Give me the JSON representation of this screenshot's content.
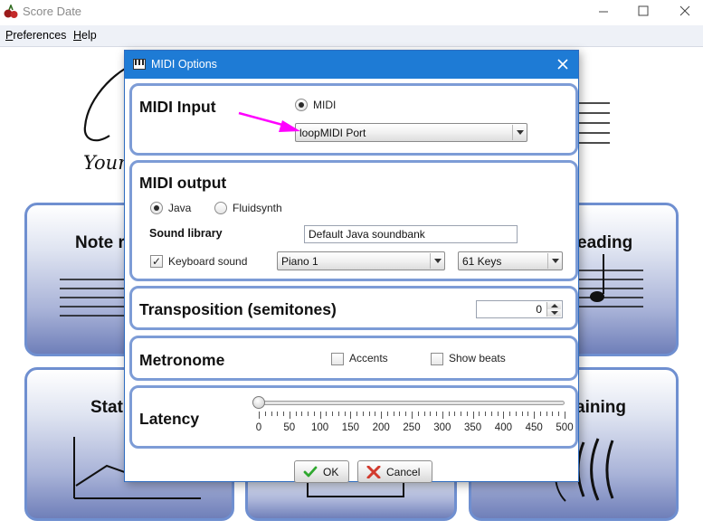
{
  "window": {
    "title": "Score Date",
    "controls": {
      "minimize": "minimize-icon",
      "maximize": "maximize-icon",
      "close": "close-icon"
    }
  },
  "menu": {
    "preferences": {
      "mnemonic": "P",
      "rest": "references"
    },
    "help": {
      "mnemonic": "H",
      "rest": "elp"
    }
  },
  "background": {
    "logo_tagline": "Your",
    "tiles": {
      "note_reading": "Note r",
      "rhythm_reading": "eading",
      "statistics": "Stat",
      "ear_training": "aining"
    }
  },
  "dialog": {
    "title": "MIDI Options",
    "icon": "piano-keyboard-icon",
    "midi_input": {
      "title": "MIDI Input",
      "radio_label": "MIDI",
      "radio_selected": true,
      "port": "loopMIDI Port"
    },
    "midi_output": {
      "title": "MIDI output",
      "radio_java": "Java",
      "radio_fluidsynth": "Fluidsynth",
      "selected": "Java",
      "sound_library_label": "Sound library",
      "sound_library_value": "Default Java soundbank",
      "keyboard_sound_label": "Keyboard sound",
      "keyboard_sound_checked": true,
      "instrument": "Piano 1",
      "keys": "61 Keys"
    },
    "transposition": {
      "title": "Transposition (semitones)",
      "value": "0"
    },
    "metronome": {
      "title": "Metronome",
      "accents_label": "Accents",
      "accents_checked": false,
      "show_beats_label": "Show beats",
      "show_beats_checked": false
    },
    "latency": {
      "title": "Latency",
      "value": 0,
      "min": 0,
      "max": 500,
      "ticks": [
        "0",
        "50",
        "100",
        "150",
        "200",
        "250",
        "300",
        "350",
        "400",
        "450",
        "500"
      ]
    },
    "buttons": {
      "ok": "OK",
      "cancel": "Cancel"
    }
  },
  "annotation": {
    "arrow_color": "#ff00ff"
  },
  "colors": {
    "dialog_title_bg": "#1e7bd5",
    "panel_border": "#7d9cd6",
    "tile_border": "#6f8fd0"
  }
}
